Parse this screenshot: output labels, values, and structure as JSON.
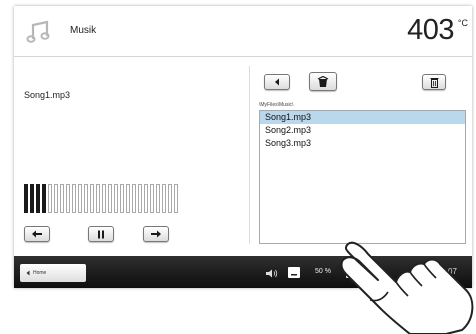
{
  "header": {
    "app_icon": "music-note-icon",
    "title": "Musik",
    "temperature": "403",
    "temperature_unit": "°C"
  },
  "player": {
    "current_song": "Song1.mp3",
    "volume_level": 4,
    "volume_steps": 26,
    "controls": {
      "previous_icon": "arrow-left-icon",
      "pause_icon": "pause-icon",
      "next_icon": "arrow-right-icon"
    }
  },
  "browser": {
    "path": "\\MyFiles\\Music\\",
    "back_icon": "chevron-left-icon",
    "folder_icon": "open-folder-icon",
    "delete_icon": "trash-icon",
    "files": [
      {
        "name": "Song1.mp3",
        "selected": true
      },
      {
        "name": "Song2.mp3",
        "selected": false
      },
      {
        "name": "Song3.mp3",
        "selected": false
      }
    ]
  },
  "footer": {
    "home_label": "Home",
    "home_icon": "chevron-left-icon",
    "speaker_icon": "speaker-icon",
    "volume_text": "50 %",
    "clock_partial": "07"
  },
  "colors": {
    "selection": "#b9d8ec",
    "footer_bg": "#1a1a1a"
  }
}
